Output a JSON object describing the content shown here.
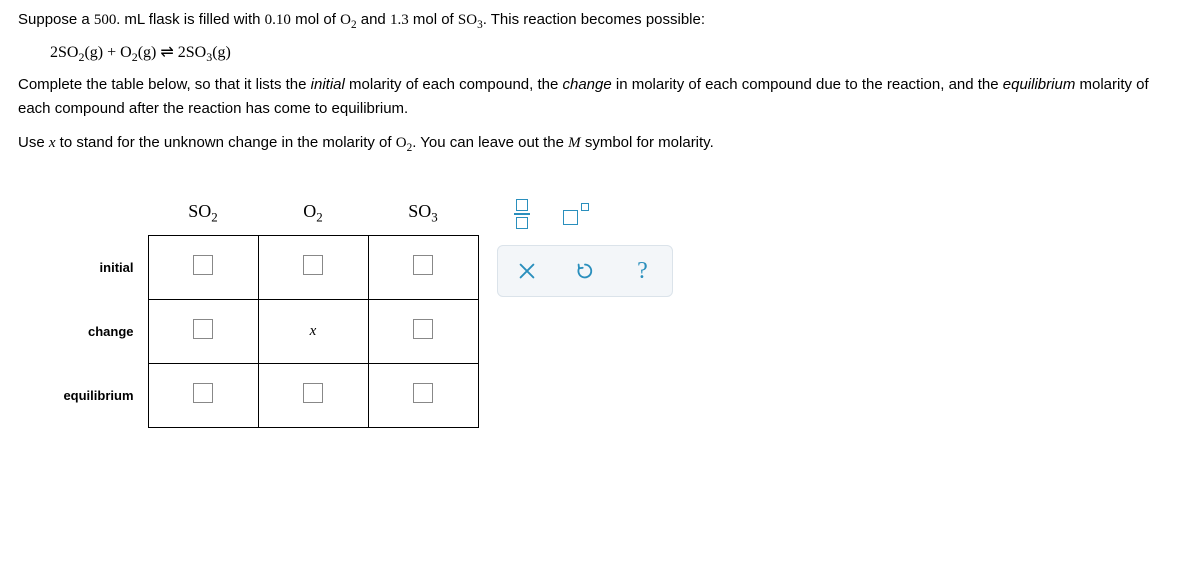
{
  "problem": {
    "line1_a": "Suppose a ",
    "line1_vol": "500.",
    "line1_b": " mL flask is filled with ",
    "line1_mol1": "0.10",
    "line1_c": " mol of ",
    "line1_sp1": "O",
    "line1_sp1_sub": "2",
    "line1_d": " and ",
    "line1_mol2": "1.3",
    "line1_e": " mol of ",
    "line1_sp2": "SO",
    "line1_sp2_sub": "3",
    "line1_f": ". This reaction becomes possible:"
  },
  "equation": {
    "c1": "2",
    "sp1": "SO",
    "sp1_sub": "2",
    "st1": "(g)",
    "plus": " + ",
    "sp2": "O",
    "sp2_sub": "2",
    "st2": "(g)",
    "arrow": " ⇌ ",
    "c2": "2",
    "sp3": "SO",
    "sp3_sub": "3",
    "st3": "(g)"
  },
  "instr": {
    "line2_a": "Complete the table below, so that it lists the ",
    "line2_i1": "initial",
    "line2_b": " molarity of each compound, the ",
    "line2_i2": "change",
    "line2_c": " in molarity of each compound due to the reaction, and the ",
    "line2_i3": "equilibrium",
    "line2_d": " molarity of each compound after the reaction has come to equilibrium.",
    "line3_a": "Use ",
    "line3_x": "x",
    "line3_b": " to stand for the unknown change in the molarity of ",
    "line3_sp": "O",
    "line3_sp_sub": "2",
    "line3_c": ". You can leave out the ",
    "line3_m": "M",
    "line3_d": " symbol for molarity."
  },
  "table": {
    "col1": "SO",
    "col1_sub": "2",
    "col2": "O",
    "col2_sub": "2",
    "col3": "SO",
    "col3_sub": "3",
    "row1": "initial",
    "row2": "change",
    "row3": "equilibrium",
    "change_o2": "x"
  }
}
